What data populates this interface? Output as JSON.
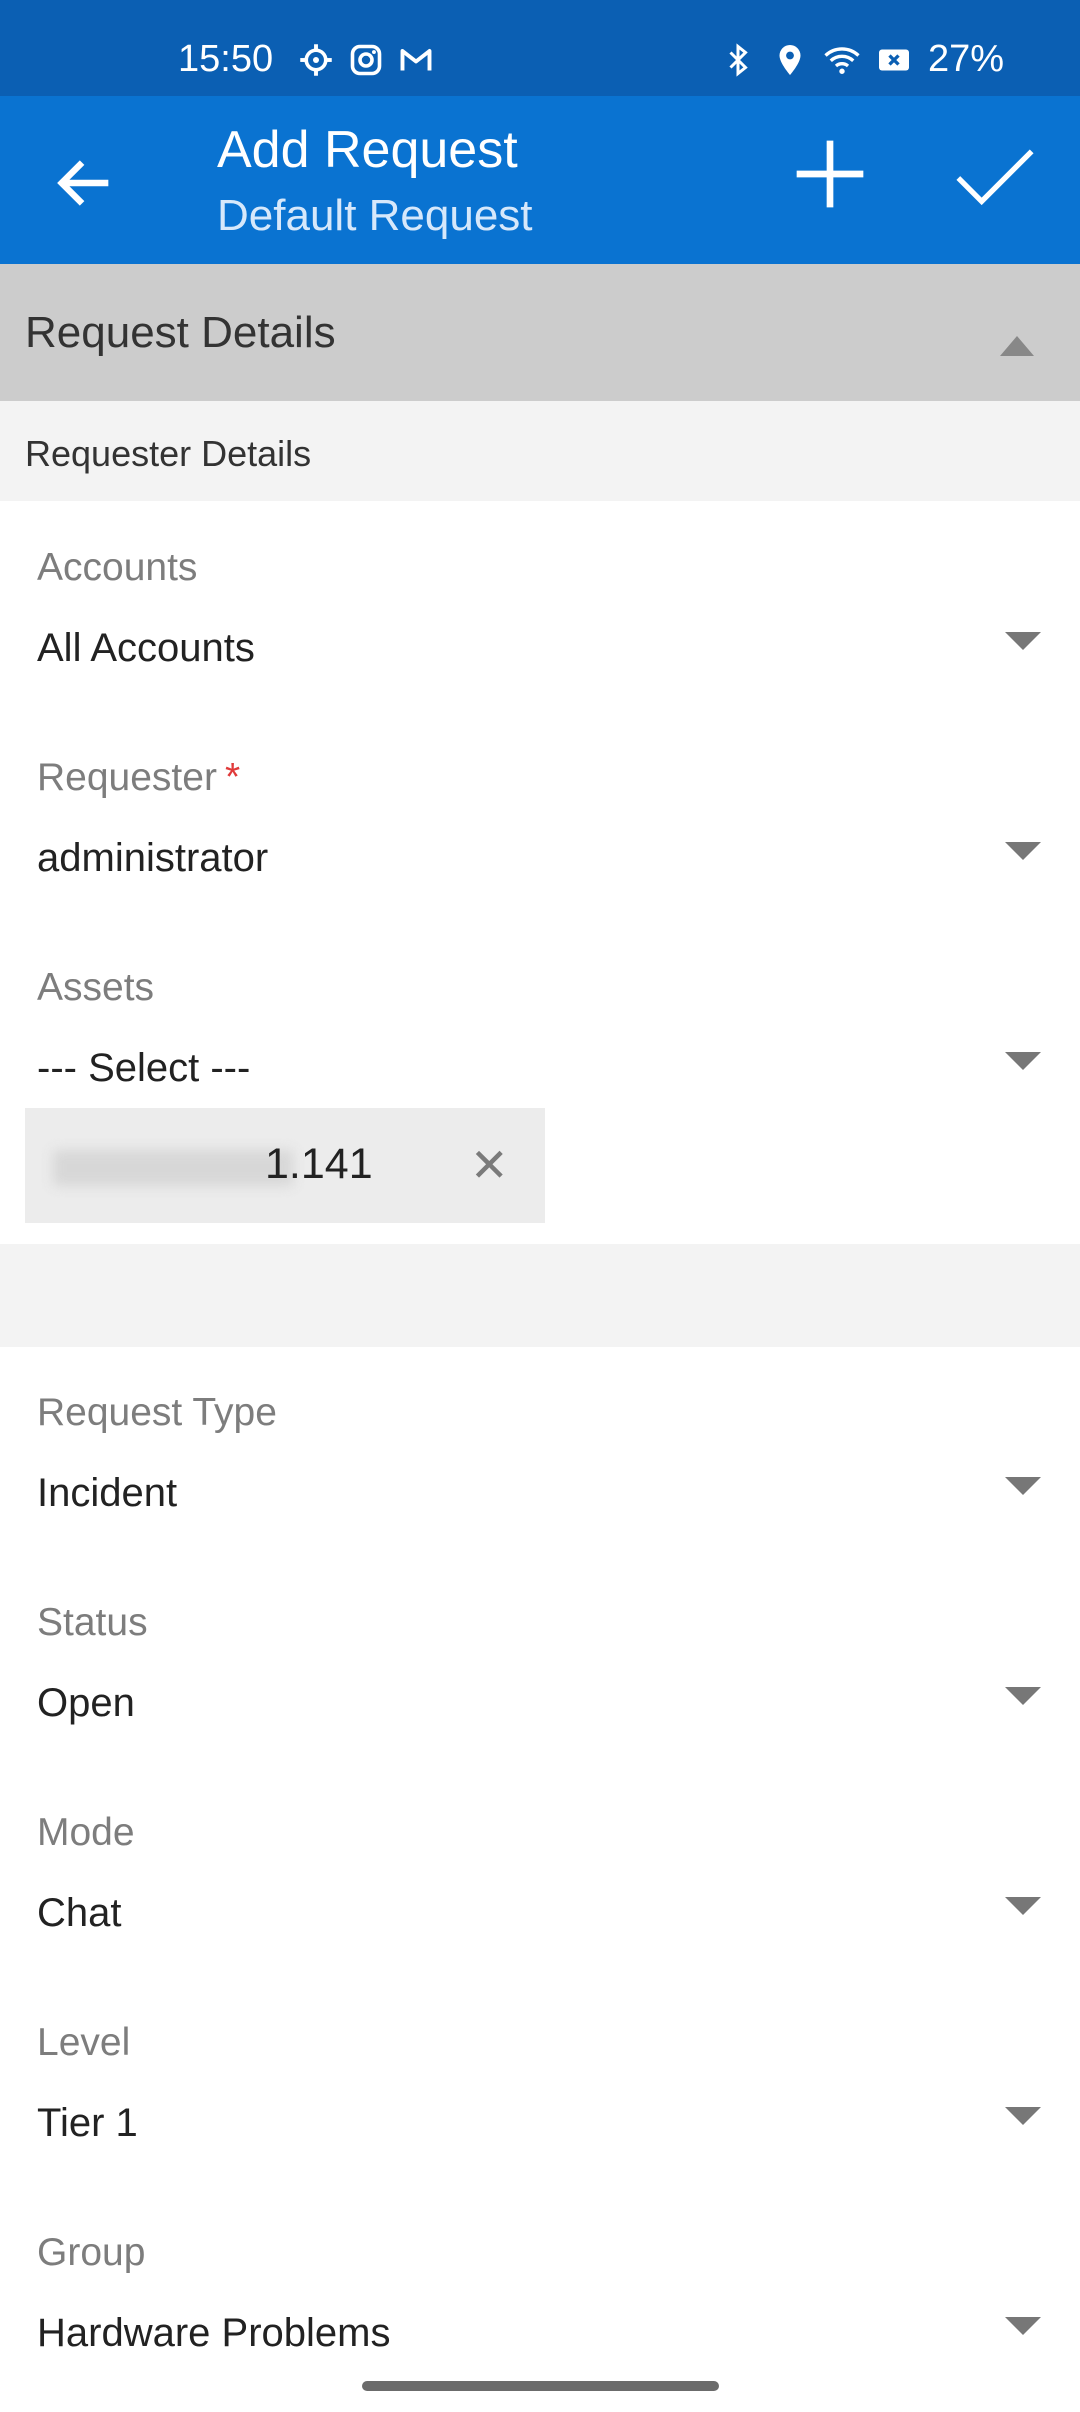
{
  "status_bar": {
    "time": "15:50",
    "battery": "27%",
    "left_icons": [
      "settings-icon",
      "instagram-icon",
      "gmail-icon"
    ],
    "right_icons": [
      "bluetooth-icon",
      "location-icon",
      "wifi-icon",
      "no-sim-icon"
    ]
  },
  "app_bar": {
    "title": "Add Request",
    "subtitle": "Default Request",
    "background": "#0a73d1"
  },
  "section": {
    "title": "Request Details",
    "subsection_title": "Requester Details"
  },
  "fields": {
    "accounts": {
      "label": "Accounts",
      "value": "All Accounts"
    },
    "requester": {
      "label": "Requester",
      "required_mark": "*",
      "value": "administrator"
    },
    "assets": {
      "label": "Assets",
      "value": "--- Select ---",
      "chip_visible_text": "1.141"
    },
    "request_type": {
      "label": "Request Type",
      "value": "Incident"
    },
    "status": {
      "label": "Status",
      "value": "Open"
    },
    "mode": {
      "label": "Mode",
      "value": "Chat"
    },
    "level": {
      "label": "Level",
      "value": "Tier 1"
    },
    "group": {
      "label": "Group",
      "value": "Hardware Problems"
    }
  },
  "colors": {
    "status_bar": "#0b5fb3",
    "accent": "#0a73d1",
    "required": "#e03a3a",
    "section_header": "#cccccc"
  }
}
